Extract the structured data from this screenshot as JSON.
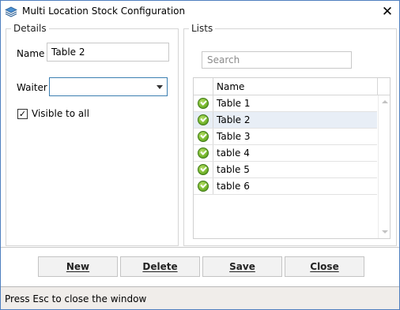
{
  "window": {
    "title": "Multi Location Stock Configuration",
    "app_icon": "stack-layers-icon",
    "close_icon": "close-icon",
    "close_glyph": "✕"
  },
  "details": {
    "group_title": "Details",
    "name_label": "Name",
    "name_value": "Table 2",
    "waiter_label": "Waiter",
    "waiter_value": "",
    "visible_label": "Visible to all",
    "visible_checked": true,
    "check_glyph": "✓"
  },
  "lists": {
    "group_title": "Lists",
    "search_placeholder": "Search",
    "column_name": "Name",
    "rows": [
      {
        "name": "Table 1",
        "selected": false
      },
      {
        "name": "Table 2",
        "selected": true
      },
      {
        "name": "Table 3",
        "selected": false
      },
      {
        "name": "table 4",
        "selected": false
      },
      {
        "name": "table 5",
        "selected": false
      },
      {
        "name": "table 6",
        "selected": false
      }
    ]
  },
  "buttons": {
    "new": "New",
    "delete": "Delete",
    "save": "Save",
    "close": "Close"
  },
  "status": {
    "text": "Press Esc to close the window"
  },
  "colors": {
    "accent_border": "#3c7fb1",
    "selected_row": "#e8eef6",
    "status_bg": "#f0edea",
    "check_green": "#74b52c"
  }
}
